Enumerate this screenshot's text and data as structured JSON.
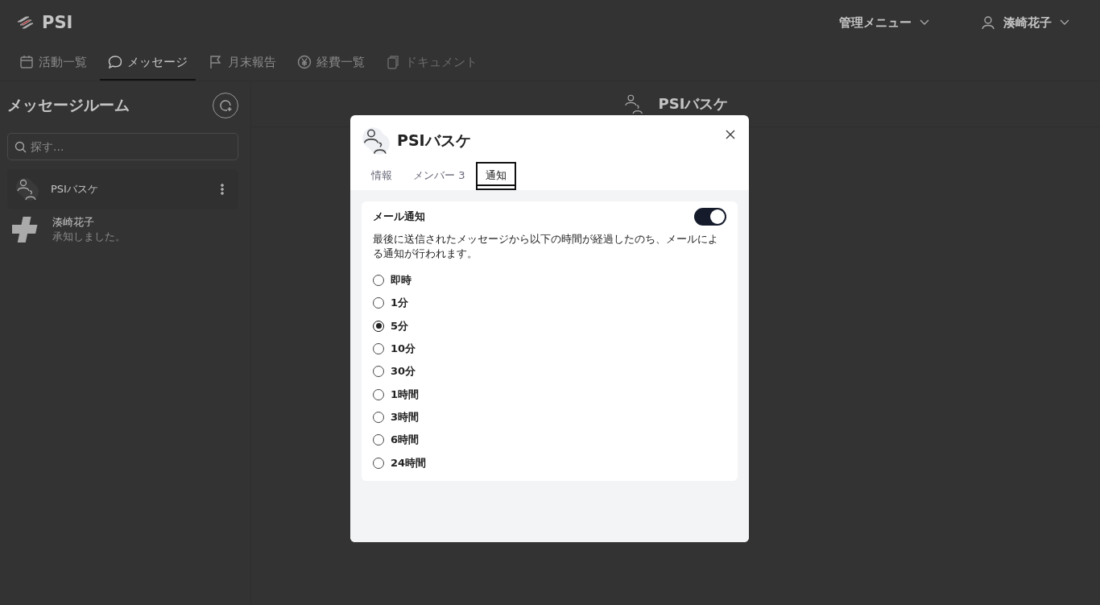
{
  "header": {
    "logo_text": "PSI",
    "admin_menu": "管理メニュー",
    "user_name": "湊崎花子"
  },
  "nav_tabs": [
    {
      "label": "活動一覧",
      "kind": "calendar",
      "selected": false,
      "disabled": false
    },
    {
      "label": "メッセージ",
      "kind": "chat",
      "selected": true,
      "disabled": false
    },
    {
      "label": "月末報告",
      "kind": "flag",
      "selected": false,
      "disabled": false
    },
    {
      "label": "経費一覧",
      "kind": "yen",
      "selected": false,
      "disabled": false
    },
    {
      "label": "ドキュメント",
      "kind": "document",
      "selected": false,
      "disabled": true
    }
  ],
  "sidebar": {
    "title": "メッセージルーム",
    "search": {
      "placeholder": "探す..."
    },
    "rooms": [
      {
        "kind": "group",
        "name": "PSIバスケ",
        "selected": true
      },
      {
        "kind": "person",
        "name": "湊崎花子",
        "preview": "承知しました。",
        "selected": false
      }
    ]
  },
  "main": {
    "room_title": "PSIバスケ"
  },
  "dialog": {
    "title": "PSIバスケ",
    "tabs": [
      {
        "label": "情報",
        "selected": false
      },
      {
        "label": "メンバー 3",
        "selected": false
      },
      {
        "label": "通知",
        "selected": true
      }
    ],
    "email_notification": {
      "label": "メール通知",
      "on": true,
      "description": "最後に送信されたメッセージから以下の時間が経過したのち、メールによる通知が行われます。"
    },
    "options": [
      {
        "label": "即時",
        "selected": false
      },
      {
        "label": "1分",
        "selected": false
      },
      {
        "label": "5分",
        "selected": true
      },
      {
        "label": "10分",
        "selected": false
      },
      {
        "label": "30分",
        "selected": false
      },
      {
        "label": "1時間",
        "selected": false
      },
      {
        "label": "3時間",
        "selected": false
      },
      {
        "label": "6時間",
        "selected": false
      },
      {
        "label": "24時間",
        "selected": false
      }
    ]
  }
}
